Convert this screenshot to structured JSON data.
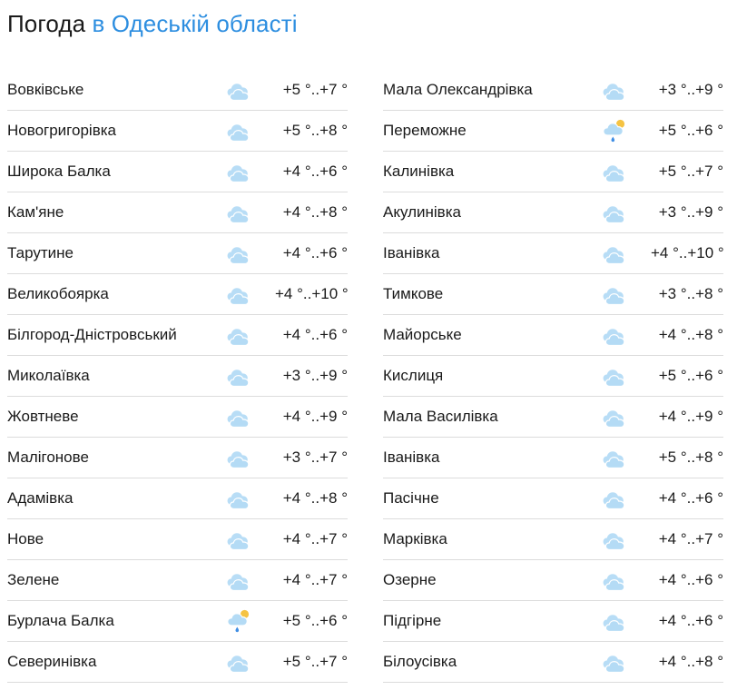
{
  "header": {
    "title_prefix": "Погода",
    "title_region": " в Одеській області"
  },
  "icon_names": {
    "cloud": "cloud-icon",
    "sun_rain": "cloud-sun-rain-icon"
  },
  "colors": {
    "accent": "#2d8ee0",
    "cloud": "#b4dbf5",
    "sun": "#f5c343",
    "rain": "#3f8ee4",
    "divider": "#dcdcdc"
  },
  "columns": [
    [
      {
        "name": "Вовківське",
        "temp": "+5 °..+7 °",
        "icon": "cloud"
      },
      {
        "name": "Новогригорівка",
        "temp": "+5 °..+8 °",
        "icon": "cloud"
      },
      {
        "name": "Широка Балка",
        "temp": "+4 °..+6 °",
        "icon": "cloud"
      },
      {
        "name": "Кам'яне",
        "temp": "+4 °..+8 °",
        "icon": "cloud"
      },
      {
        "name": "Тарутине",
        "temp": "+4 °..+6 °",
        "icon": "cloud"
      },
      {
        "name": "Великобоярка",
        "temp": "+4 °..+10 °",
        "icon": "cloud"
      },
      {
        "name": "Білгород-Дністровський",
        "temp": "+4 °..+6 °",
        "icon": "cloud"
      },
      {
        "name": "Миколаївка",
        "temp": "+3 °..+9 °",
        "icon": "cloud"
      },
      {
        "name": "Жовтневе",
        "temp": "+4 °..+9 °",
        "icon": "cloud"
      },
      {
        "name": "Малігонове",
        "temp": "+3 °..+7 °",
        "icon": "cloud"
      },
      {
        "name": "Адамівка",
        "temp": "+4 °..+8 °",
        "icon": "cloud"
      },
      {
        "name": "Нове",
        "temp": "+4 °..+7 °",
        "icon": "cloud"
      },
      {
        "name": "Зелене",
        "temp": "+4 °..+7 °",
        "icon": "cloud"
      },
      {
        "name": "Бурлача Балка",
        "temp": "+5 °..+6 °",
        "icon": "sun_rain"
      },
      {
        "name": "Северинівка",
        "temp": "+5 °..+7 °",
        "icon": "cloud"
      }
    ],
    [
      {
        "name": "Мала Олександрівка",
        "temp": "+3 °..+9 °",
        "icon": "cloud"
      },
      {
        "name": "Переможне",
        "temp": "+5 °..+6 °",
        "icon": "sun_rain"
      },
      {
        "name": "Калинівка",
        "temp": "+5 °..+7 °",
        "icon": "cloud"
      },
      {
        "name": "Акулинівка",
        "temp": "+3 °..+9 °",
        "icon": "cloud"
      },
      {
        "name": "Іванівка",
        "temp": "+4 °..+10 °",
        "icon": "cloud"
      },
      {
        "name": "Тимкове",
        "temp": "+3 °..+8 °",
        "icon": "cloud"
      },
      {
        "name": "Майорське",
        "temp": "+4 °..+8 °",
        "icon": "cloud"
      },
      {
        "name": "Кислиця",
        "temp": "+5 °..+6 °",
        "icon": "cloud"
      },
      {
        "name": "Мала Василівка",
        "temp": "+4 °..+9 °",
        "icon": "cloud"
      },
      {
        "name": "Іванівка",
        "temp": "+5 °..+8 °",
        "icon": "cloud"
      },
      {
        "name": "Пасічне",
        "temp": "+4 °..+6 °",
        "icon": "cloud"
      },
      {
        "name": "Марківка",
        "temp": "+4 °..+7 °",
        "icon": "cloud"
      },
      {
        "name": "Озерне",
        "temp": "+4 °..+6 °",
        "icon": "cloud"
      },
      {
        "name": "Підгірне",
        "temp": "+4 °..+6 °",
        "icon": "cloud"
      },
      {
        "name": "Білоусівка",
        "temp": "+4 °..+8 °",
        "icon": "cloud"
      }
    ]
  ]
}
